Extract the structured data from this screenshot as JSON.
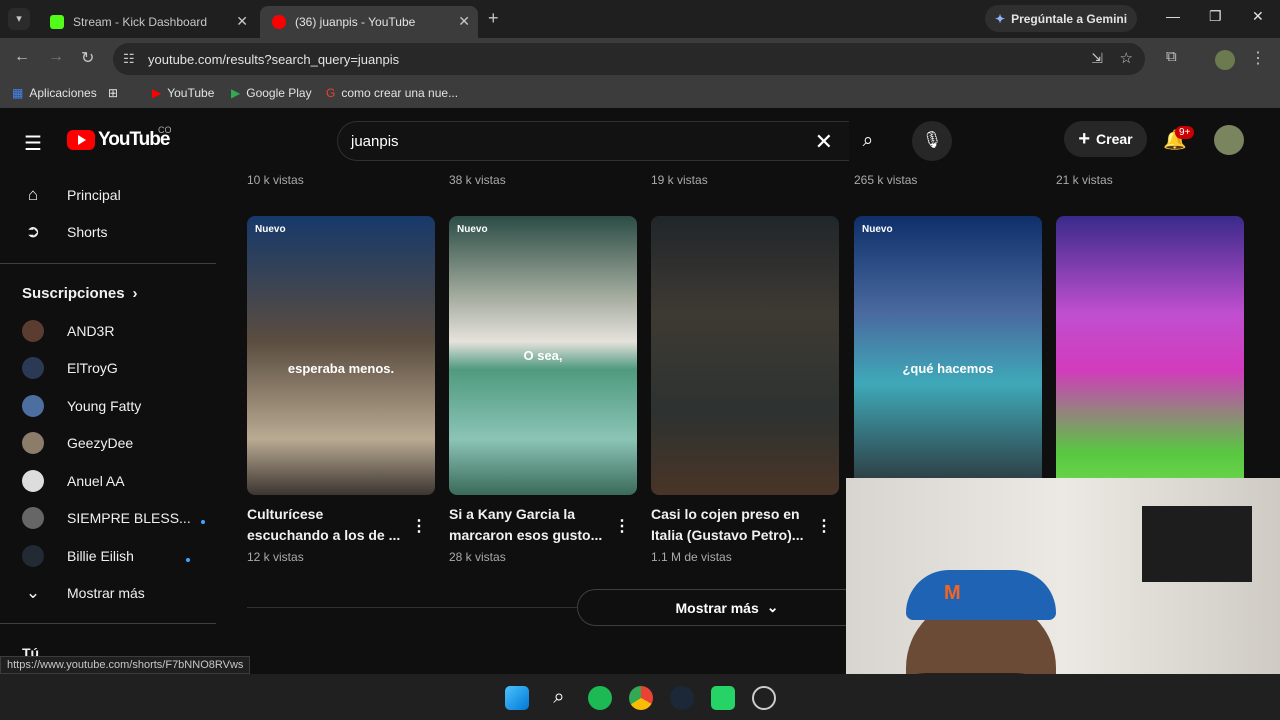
{
  "browser": {
    "tabs": [
      {
        "title": "Stream - Kick Dashboard",
        "active": false,
        "favicon_color": "#53fc18"
      },
      {
        "title": "(36) juanpis - YouTube",
        "active": true,
        "favicon_color": "#ff0000"
      }
    ],
    "gemini_label": "Pregúntale a Gemini",
    "url": "youtube.com/results?search_query=juanpis",
    "bookmarks": [
      "Aplicaciones",
      "YouTube",
      "Google Play",
      "como crear una nue..."
    ]
  },
  "youtube": {
    "logo_text": "YouTube",
    "country": "CO",
    "search_value": "juanpis",
    "create_label": "Crear",
    "notifications_badge": "9+",
    "sidebar": {
      "main": [
        {
          "label": "Principal",
          "icon": "home-icon"
        },
        {
          "label": "Shorts",
          "icon": "shorts-icon"
        }
      ],
      "subscriptions_title": "Suscripciones",
      "subscriptions": [
        {
          "label": "AND3R",
          "new": false,
          "color": "#5a3d30"
        },
        {
          "label": "ElTroyG",
          "new": false,
          "color": "#2a3a55"
        },
        {
          "label": "Young Fatty",
          "new": false,
          "color": "#4d6fa0"
        },
        {
          "label": "GeezyDee",
          "new": false,
          "color": "#8b7d6a"
        },
        {
          "label": "Anuel AA",
          "new": false,
          "color": "#dddddd"
        },
        {
          "label": "SIEMPRE BLESS...",
          "new": true,
          "color": "#666666"
        },
        {
          "label": "Billie Eilish",
          "new": true,
          "color": "#222a33"
        }
      ],
      "show_more": "Mostrar más",
      "you_label": "Tú"
    },
    "top_row_views": [
      "10 k vistas",
      "38 k vistas",
      "19 k vistas",
      "265 k vistas",
      "21 k vistas"
    ],
    "shorts": [
      {
        "badge": "Nuevo",
        "caption": "esperaba menos.",
        "title": "Culturícese escuchando a los de ...",
        "views": "12 k vistas",
        "bg": "#8a7a66"
      },
      {
        "badge": "Nuevo",
        "caption": "O sea,",
        "title": "Si a Kany Garcia la marcaron esos gusto...",
        "views": "28 k vistas",
        "bg": "#7fa89a"
      },
      {
        "badge": "",
        "caption": "",
        "title": "Casi lo cojen preso en Italia (Gustavo Petro)...",
        "views": "1.1 M de vistas",
        "bg": "#3a2f26"
      },
      {
        "badge": "Nuevo",
        "caption": "¿qué hacemos",
        "title": "",
        "views": "",
        "bg": "#2f6fa8"
      },
      {
        "badge": "",
        "caption": "",
        "title": "",
        "views": "",
        "bg": "#7a3fb0"
      }
    ],
    "show_more_button": "Mostrar más",
    "status_url": "https://www.youtube.com/shorts/F7bNNO8RVws"
  }
}
